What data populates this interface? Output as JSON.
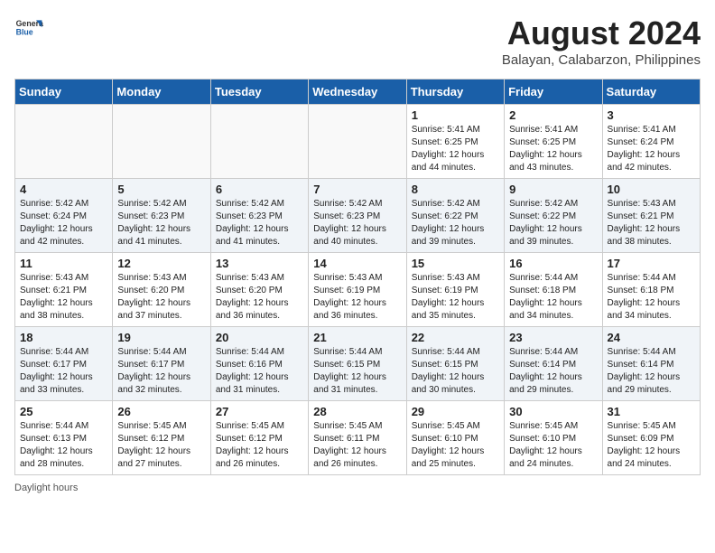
{
  "header": {
    "logo_general": "General",
    "logo_blue": "Blue",
    "month_title": "August 2024",
    "subtitle": "Balayan, Calabarzon, Philippines"
  },
  "weekdays": [
    "Sunday",
    "Monday",
    "Tuesday",
    "Wednesday",
    "Thursday",
    "Friday",
    "Saturday"
  ],
  "days": [
    {
      "date": 0,
      "empty": true
    },
    {
      "date": 0,
      "empty": true
    },
    {
      "date": 0,
      "empty": true
    },
    {
      "date": 0,
      "empty": true
    },
    {
      "date": 1,
      "sunrise": "5:41 AM",
      "sunset": "6:25 PM",
      "daylight": "12 hours and 44 minutes."
    },
    {
      "date": 2,
      "sunrise": "5:41 AM",
      "sunset": "6:25 PM",
      "daylight": "12 hours and 43 minutes."
    },
    {
      "date": 3,
      "sunrise": "5:41 AM",
      "sunset": "6:24 PM",
      "daylight": "12 hours and 42 minutes."
    },
    {
      "date": 4,
      "sunrise": "5:42 AM",
      "sunset": "6:24 PM",
      "daylight": "12 hours and 42 minutes."
    },
    {
      "date": 5,
      "sunrise": "5:42 AM",
      "sunset": "6:23 PM",
      "daylight": "12 hours and 41 minutes."
    },
    {
      "date": 6,
      "sunrise": "5:42 AM",
      "sunset": "6:23 PM",
      "daylight": "12 hours and 41 minutes."
    },
    {
      "date": 7,
      "sunrise": "5:42 AM",
      "sunset": "6:23 PM",
      "daylight": "12 hours and 40 minutes."
    },
    {
      "date": 8,
      "sunrise": "5:42 AM",
      "sunset": "6:22 PM",
      "daylight": "12 hours and 39 minutes."
    },
    {
      "date": 9,
      "sunrise": "5:42 AM",
      "sunset": "6:22 PM",
      "daylight": "12 hours and 39 minutes."
    },
    {
      "date": 10,
      "sunrise": "5:43 AM",
      "sunset": "6:21 PM",
      "daylight": "12 hours and 38 minutes."
    },
    {
      "date": 11,
      "sunrise": "5:43 AM",
      "sunset": "6:21 PM",
      "daylight": "12 hours and 38 minutes."
    },
    {
      "date": 12,
      "sunrise": "5:43 AM",
      "sunset": "6:20 PM",
      "daylight": "12 hours and 37 minutes."
    },
    {
      "date": 13,
      "sunrise": "5:43 AM",
      "sunset": "6:20 PM",
      "daylight": "12 hours and 36 minutes."
    },
    {
      "date": 14,
      "sunrise": "5:43 AM",
      "sunset": "6:19 PM",
      "daylight": "12 hours and 36 minutes."
    },
    {
      "date": 15,
      "sunrise": "5:43 AM",
      "sunset": "6:19 PM",
      "daylight": "12 hours and 35 minutes."
    },
    {
      "date": 16,
      "sunrise": "5:44 AM",
      "sunset": "6:18 PM",
      "daylight": "12 hours and 34 minutes."
    },
    {
      "date": 17,
      "sunrise": "5:44 AM",
      "sunset": "6:18 PM",
      "daylight": "12 hours and 34 minutes."
    },
    {
      "date": 18,
      "sunrise": "5:44 AM",
      "sunset": "6:17 PM",
      "daylight": "12 hours and 33 minutes."
    },
    {
      "date": 19,
      "sunrise": "5:44 AM",
      "sunset": "6:17 PM",
      "daylight": "12 hours and 32 minutes."
    },
    {
      "date": 20,
      "sunrise": "5:44 AM",
      "sunset": "6:16 PM",
      "daylight": "12 hours and 31 minutes."
    },
    {
      "date": 21,
      "sunrise": "5:44 AM",
      "sunset": "6:15 PM",
      "daylight": "12 hours and 31 minutes."
    },
    {
      "date": 22,
      "sunrise": "5:44 AM",
      "sunset": "6:15 PM",
      "daylight": "12 hours and 30 minutes."
    },
    {
      "date": 23,
      "sunrise": "5:44 AM",
      "sunset": "6:14 PM",
      "daylight": "12 hours and 29 minutes."
    },
    {
      "date": 24,
      "sunrise": "5:44 AM",
      "sunset": "6:14 PM",
      "daylight": "12 hours and 29 minutes."
    },
    {
      "date": 25,
      "sunrise": "5:44 AM",
      "sunset": "6:13 PM",
      "daylight": "12 hours and 28 minutes."
    },
    {
      "date": 26,
      "sunrise": "5:45 AM",
      "sunset": "6:12 PM",
      "daylight": "12 hours and 27 minutes."
    },
    {
      "date": 27,
      "sunrise": "5:45 AM",
      "sunset": "6:12 PM",
      "daylight": "12 hours and 26 minutes."
    },
    {
      "date": 28,
      "sunrise": "5:45 AM",
      "sunset": "6:11 PM",
      "daylight": "12 hours and 26 minutes."
    },
    {
      "date": 29,
      "sunrise": "5:45 AM",
      "sunset": "6:10 PM",
      "daylight": "12 hours and 25 minutes."
    },
    {
      "date": 30,
      "sunrise": "5:45 AM",
      "sunset": "6:10 PM",
      "daylight": "12 hours and 24 minutes."
    },
    {
      "date": 31,
      "sunrise": "5:45 AM",
      "sunset": "6:09 PM",
      "daylight": "12 hours and 24 minutes."
    }
  ],
  "footer": {
    "note": "Daylight hours"
  }
}
